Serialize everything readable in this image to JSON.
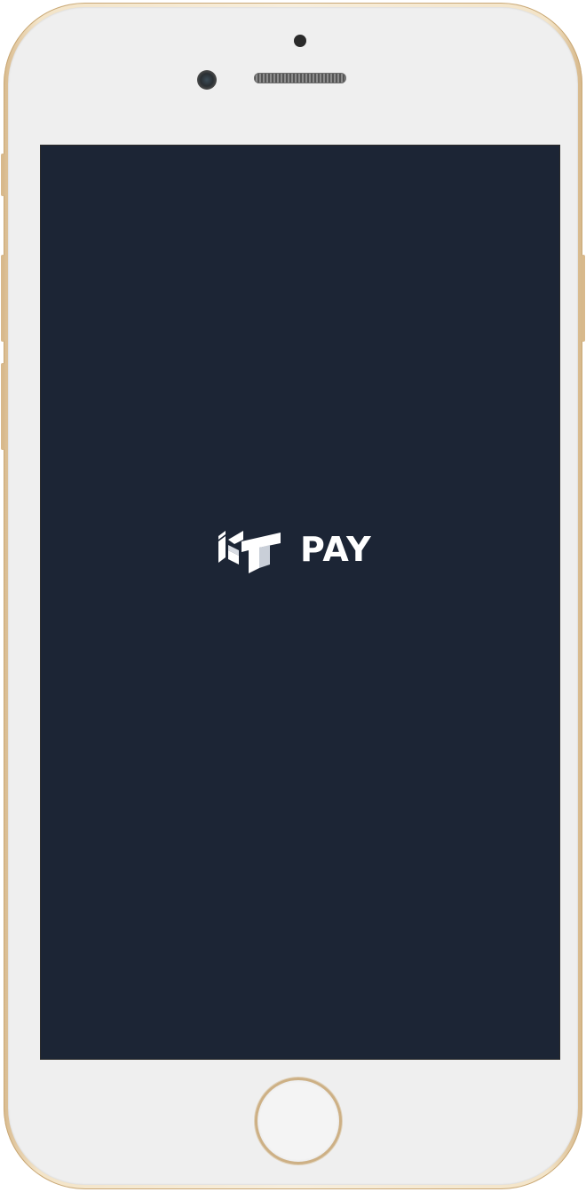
{
  "app": {
    "logo_icon": "ist-logo-icon",
    "logo_text": "PAY"
  },
  "device": {
    "frame_color": "#e9d6b5",
    "face_color": "#efefef",
    "screen_background": "#1c2535"
  },
  "icons": {
    "front_camera": "front-camera-icon",
    "speaker": "speaker-grille-icon",
    "home": "home-button-icon"
  }
}
